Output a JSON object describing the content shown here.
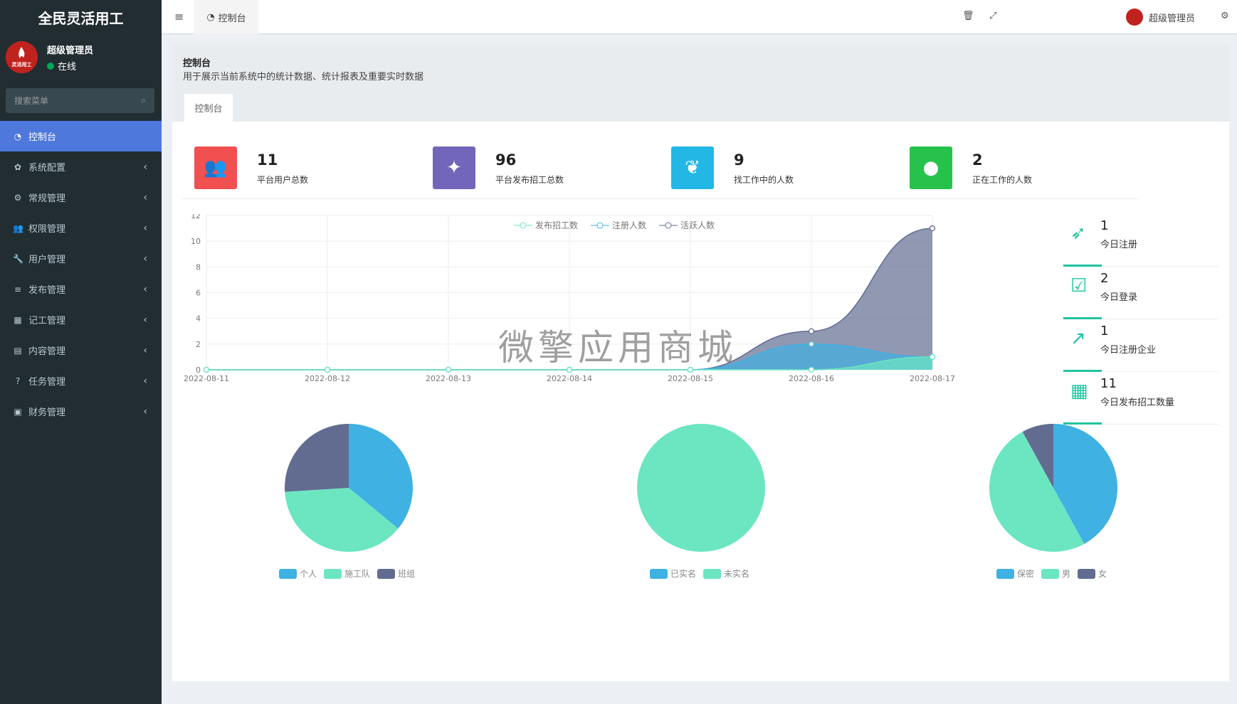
{
  "app": {
    "title": "全民灵活用工",
    "logo_badge": "灵活用工"
  },
  "user": {
    "name": "超级管理员",
    "status": "在线"
  },
  "search": {
    "placeholder": "搜索菜单"
  },
  "menu": [
    {
      "label": "控制台",
      "icon": "dashboard-icon",
      "active": true
    },
    {
      "label": "系统配置",
      "icon": "gear-icon"
    },
    {
      "label": "常规管理",
      "icon": "cogs-icon"
    },
    {
      "label": "权限管理",
      "icon": "users-icon"
    },
    {
      "label": "用户管理",
      "icon": "wrench-icon"
    },
    {
      "label": "发布管理",
      "icon": "list-icon"
    },
    {
      "label": "记工管理",
      "icon": "calendar-icon"
    },
    {
      "label": "内容管理",
      "icon": "file-icon"
    },
    {
      "label": "任务管理",
      "icon": "question-icon"
    },
    {
      "label": "财务管理",
      "icon": "money-icon"
    }
  ],
  "topbar": {
    "tab": "控制台",
    "user": "超级管理员"
  },
  "header": {
    "title": "控制台",
    "subtitle": "用于展示当前系统中的统计数据、统计报表及重要实时数据",
    "tab": "控制台"
  },
  "stats": [
    {
      "value": "11",
      "label": "平台用户总数",
      "color": "#f05050",
      "icon": "users-icon"
    },
    {
      "value": "96",
      "label": "平台发布招工总数",
      "color": "#7266ba",
      "icon": "magic-icon"
    },
    {
      "value": "9",
      "label": "找工作中的人数",
      "color": "#23b7e5",
      "icon": "leaf-icon"
    },
    {
      "value": "2",
      "label": "正在工作的人数",
      "color": "#27c24c",
      "icon": "user-icon"
    }
  ],
  "side_stats": [
    {
      "value": "1",
      "label": "今日注册",
      "icon": "rocket-icon"
    },
    {
      "value": "2",
      "label": "今日登录",
      "icon": "calendar-check-icon"
    },
    {
      "value": "1",
      "label": "今日注册企业",
      "icon": "chart-up-icon"
    },
    {
      "value": "11",
      "label": "今日发布招工数量",
      "icon": "calendar-icon"
    }
  ],
  "watermark": "微擎应用商城",
  "chart_data": [
    {
      "type": "area",
      "x": [
        "2022-08-11",
        "2022-08-12",
        "2022-08-13",
        "2022-08-14",
        "2022-08-15",
        "2022-08-16",
        "2022-08-17"
      ],
      "series": [
        {
          "name": "发布招工数",
          "values": [
            0,
            0,
            0,
            0,
            0,
            0,
            1
          ],
          "color": "#6be6c1"
        },
        {
          "name": "注册人数",
          "values": [
            0,
            0,
            0,
            0,
            0,
            2,
            1
          ],
          "color": "#3fb1e3"
        },
        {
          "name": "活跃人数",
          "values": [
            0,
            0,
            0,
            0,
            0,
            3,
            11
          ],
          "color": "#626c91"
        }
      ],
      "ylim": [
        0,
        12
      ],
      "yticks": [
        0,
        2,
        4,
        6,
        8,
        10,
        12
      ],
      "legend": "top-center",
      "grid": true
    },
    {
      "type": "pie",
      "labels": [
        "个人",
        "施工队",
        "班组"
      ],
      "values": [
        36,
        38,
        26
      ],
      "colors": [
        "#3fb1e3",
        "#6be6c1",
        "#626c91"
      ]
    },
    {
      "type": "pie",
      "labels": [
        "已实名",
        "未实名"
      ],
      "values": [
        0,
        100
      ],
      "colors": [
        "#3fb1e3",
        "#6be6c1"
      ]
    },
    {
      "type": "pie",
      "labels": [
        "保密",
        "男",
        "女"
      ],
      "values": [
        42,
        50,
        8
      ],
      "colors": [
        "#3fb1e3",
        "#6be6c1",
        "#626c91"
      ]
    }
  ]
}
